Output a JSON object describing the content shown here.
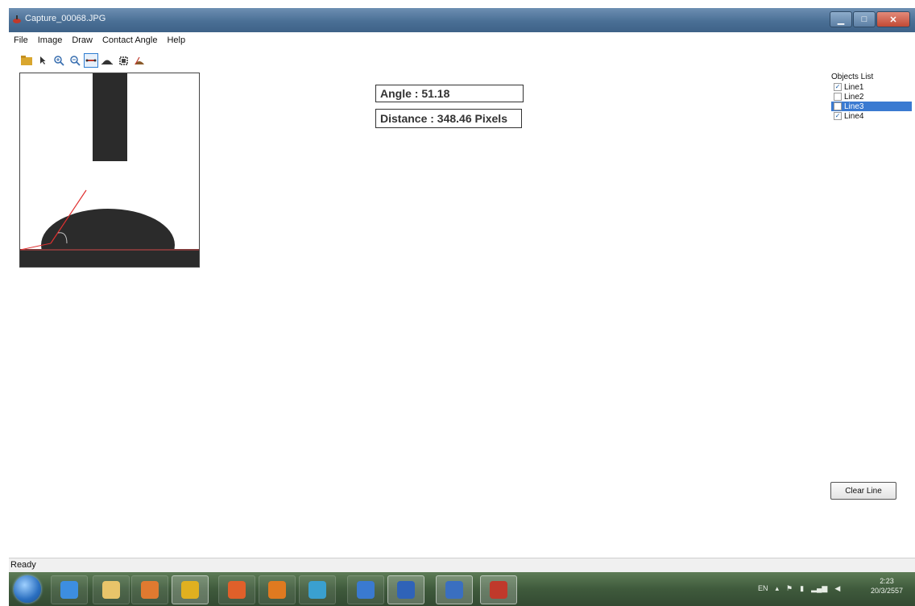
{
  "window": {
    "title": "Capture_00068.JPG"
  },
  "menu": [
    {
      "label": "File"
    },
    {
      "label": "Image"
    },
    {
      "label": "Draw"
    },
    {
      "label": "Contact Angle"
    },
    {
      "label": "Help"
    }
  ],
  "toolbar": [
    {
      "icon": "open-folder-icon"
    },
    {
      "icon": "pointer-icon"
    },
    {
      "icon": "zoom-in-icon"
    },
    {
      "icon": "zoom-out-icon"
    },
    {
      "icon": "draw-line-icon",
      "active": true
    },
    {
      "icon": "droplet-icon"
    },
    {
      "icon": "crop-icon"
    },
    {
      "icon": "contact-angle-icon"
    }
  ],
  "measurements": {
    "angle_text": "Angle : 51.18",
    "distance_text": "Distance : 348.46 Pixels"
  },
  "objects": {
    "title": "Objects List",
    "items": [
      {
        "label": "Line1",
        "checked": true,
        "selected": false
      },
      {
        "label": "Line2",
        "checked": false,
        "selected": false
      },
      {
        "label": "Line3",
        "checked": false,
        "selected": true
      },
      {
        "label": "Line4",
        "checked": true,
        "selected": false
      }
    ]
  },
  "clear_button": {
    "label": "Clear Line"
  },
  "status": {
    "text": "Ready"
  },
  "taskbar": {
    "apps": [
      {
        "icon": "internet-explorer-icon",
        "color": "#3d8ee0",
        "running": false
      },
      {
        "icon": "file-explorer-icon",
        "color": "#e8c46a",
        "running": false
      },
      {
        "icon": "media-player-icon",
        "color": "#e07a30",
        "running": false
      },
      {
        "icon": "chrome-icon",
        "color": "#e0b020",
        "running": true
      },
      {
        "icon": "snipping-tool-icon",
        "color": "#e0602a",
        "running": false
      },
      {
        "icon": "firefox-icon",
        "color": "#e07a20",
        "running": false
      },
      {
        "icon": "network-icon",
        "color": "#3aa0d0",
        "running": false
      },
      {
        "icon": "swirl-app-icon",
        "color": "#3a7ad0",
        "running": false
      },
      {
        "icon": "word-icon",
        "color": "#2f63b8",
        "running": true
      },
      {
        "icon": "visio-icon",
        "color": "#3a6fc0",
        "running": true
      },
      {
        "icon": "contact-angle-app-icon",
        "color": "#c0392b",
        "running": true
      }
    ],
    "tray": {
      "language": "EN",
      "time": "2:23",
      "date": "20/3/2557"
    }
  }
}
